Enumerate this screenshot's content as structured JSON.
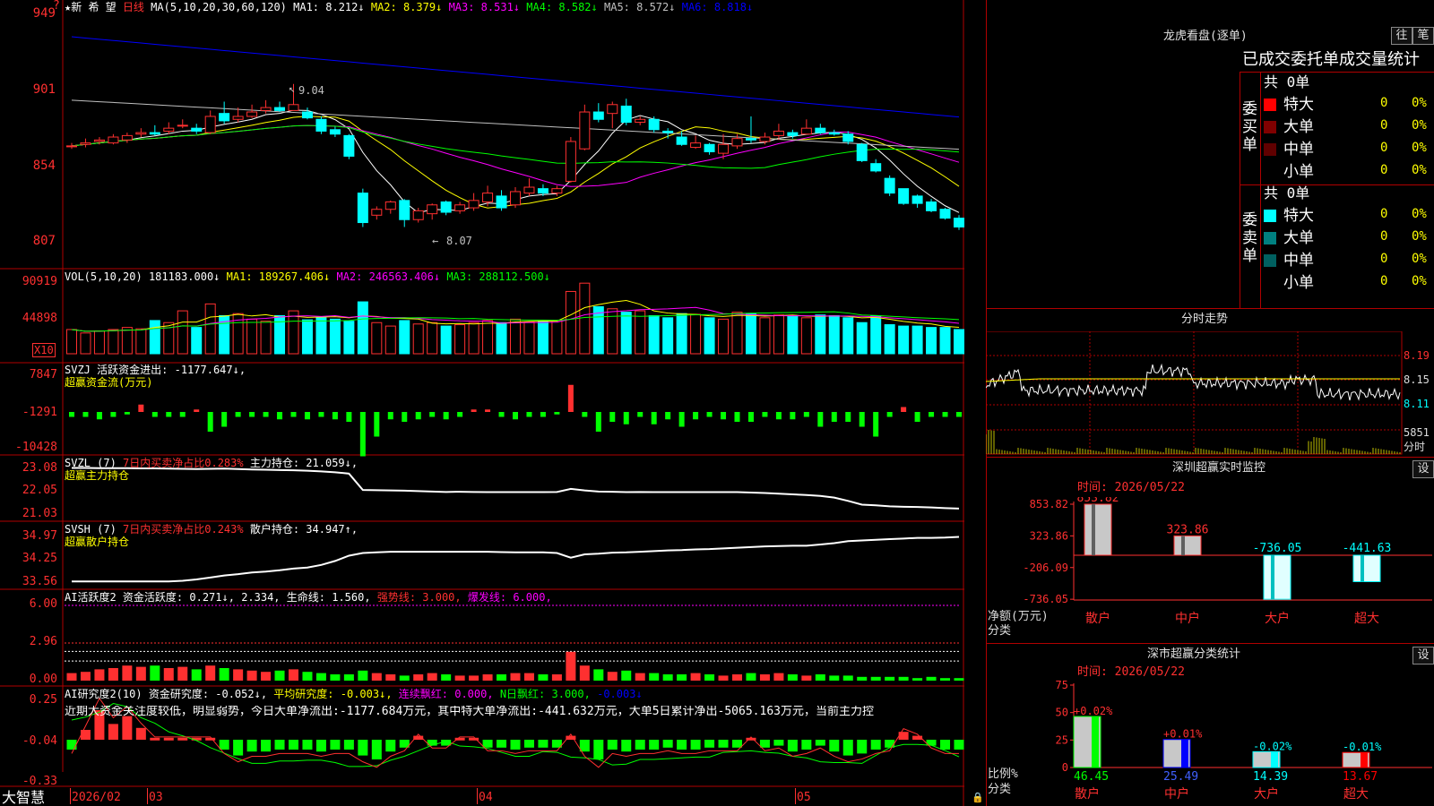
{
  "colors": {
    "up": "#ff3030",
    "down": "#00ffff",
    "grid": "#b00000",
    "ma1": "#ffffff",
    "ma2": "#ffff00",
    "ma3": "#ff00ff",
    "ma4": "#00ff00",
    "ma5": "#c0c0c0",
    "ma6": "#0000ff",
    "green": "#00ff00",
    "yellow": "#ffff00"
  },
  "header": {
    "stock": "★新 希 望",
    "period": "日线",
    "ma_def": "MA(5,10,20,30,60,120)",
    "ma": [
      {
        "label": "MA1: 8.212↓",
        "color": "#ffffff"
      },
      {
        "label": "MA2: 8.379↓",
        "color": "#ffff00"
      },
      {
        "label": "MA3: 8.531↓",
        "color": "#ff00ff"
      },
      {
        "label": "MA4: 8.582↓",
        "color": "#00ff00"
      },
      {
        "label": "MA5: 8.572↓",
        "color": "#c0c0c0"
      },
      {
        "label": "MA6: 8.818↓",
        "color": "#0000ff"
      }
    ]
  },
  "price_panel": {
    "y_labels": [
      "949",
      "901",
      "854",
      "807"
    ],
    "high_mark": "9.04",
    "low_mark": "8.07",
    "corner": "?"
  },
  "vol_panel": {
    "title": "VOL(5,10,20)",
    "value": "181183.000↓",
    "ma1": "MA1: 189267.406↓",
    "ma2": "MA2: 246563.406↓",
    "ma3": "MA3: 288112.500↓",
    "y_labels": [
      "90919",
      "44898"
    ],
    "unit": "X10"
  },
  "svzj_panel": {
    "title": "SVZJ",
    "metric": "活跃资金进出: -1177.647↓,",
    "sub": "超赢资金流(万元)",
    "y_labels": [
      "7847",
      "-1291",
      "-10428"
    ]
  },
  "svzl_panel": {
    "title": "SVZL (7)",
    "ratio": "7日内买卖净占比0.283%",
    "hold": "主力持仓: 21.059↓,",
    "sub": "超赢主力持仓",
    "y_labels": [
      "23.08",
      "22.05",
      "21.03"
    ]
  },
  "svsh_panel": {
    "title": "SVSH (7)",
    "ratio": "7日内买卖净占比0.243%",
    "hold": "散户持仓: 34.947↑,",
    "sub": "超赢散户持仓",
    "y_labels": [
      "34.97",
      "34.25",
      "33.56"
    ]
  },
  "ai_active": {
    "title": "AI活跃度2",
    "a": "资金活跃度: 0.271↓,",
    "b": "2.334,",
    "c": "生命线: 1.560,",
    "d": "强势线: 3.000,",
    "e": "爆发线: 6.000,",
    "y_labels": [
      "6.00",
      "2.96",
      "0.00"
    ]
  },
  "ai_research": {
    "title": "AI研究度2(10)",
    "a": "资金研究度: -0.052↓,",
    "b": "平均研究度: -0.003↓,",
    "c": "连续飘红: 0.000,",
    "d": "N日飘红: 3.000,",
    "e": "-0.003↓",
    "comment": "近期大资金关注度较低，明显弱势，今日大单净流出:-1177.684万元，其中特大单净流出:-441.632万元，大单5日累计净出-5065.163万元，当前主力控",
    "y_labels": [
      "0.25",
      "-0.04",
      "-0.33"
    ]
  },
  "bottom_bar": {
    "brand": "大智慧",
    "dates": [
      "2026/02",
      "03",
      "04",
      "05"
    ]
  },
  "right": {
    "top_title": "龙虎看盘(逐单)",
    "tabs": [
      "往",
      "笔"
    ],
    "table_title": "已成交委托单成交量统计",
    "buy": {
      "side": "委买单",
      "total": "共 0单",
      "rows": [
        {
          "label": "特大",
          "v": "0",
          "p": "0%",
          "c": "#ff0000"
        },
        {
          "label": "大单",
          "v": "0",
          "p": "0%",
          "c": "#800000"
        },
        {
          "label": "中单",
          "v": "0",
          "p": "0%",
          "c": "#600000"
        },
        {
          "label": "小单",
          "v": "0",
          "p": "0%",
          "c": "#000000"
        }
      ]
    },
    "sell": {
      "side": "委卖单",
      "total": "共 0单",
      "rows": [
        {
          "label": "特大",
          "v": "0",
          "p": "0%",
          "c": "#00ffff"
        },
        {
          "label": "大单",
          "v": "0",
          "p": "0%",
          "c": "#008080"
        },
        {
          "label": "中单",
          "v": "0",
          "p": "0%",
          "c": "#006060"
        },
        {
          "label": "小单",
          "v": "0",
          "p": "0%",
          "c": "#000000"
        }
      ]
    },
    "intraday": {
      "title": "分时走势",
      "y_labels": [
        "8.19",
        "8.15",
        "8.11"
      ],
      "vol_label": "5851",
      "vol_unit": "分时"
    },
    "monitor": {
      "title": "深圳超赢实时监控",
      "set": "设",
      "time": "时间: 2026/05/22",
      "y_labels": [
        "853.82",
        "323.86",
        "-206.09",
        "-736.05"
      ],
      "ylabel": "净额(万元)",
      "xlabel": "分类",
      "bars": [
        {
          "cat": "散户",
          "value": 853.82,
          "label": "853.82"
        },
        {
          "cat": "中户",
          "value": 323.86,
          "label": "323.86"
        },
        {
          "cat": "大户",
          "value": -736.05,
          "label": "-736.05"
        },
        {
          "cat": "超大",
          "value": -441.63,
          "label": "-441.63"
        }
      ]
    },
    "classify": {
      "title": "深市超赢分类统计",
      "set": "设",
      "time": "时间: 2026/05/22",
      "y_labels": [
        "75",
        "50",
        "25",
        "0"
      ],
      "ylabel": "比例%",
      "xlabel": "分类",
      "bars": [
        {
          "cat": "散户",
          "value": 46.45,
          "top": "+0.02%",
          "bottom": "46.45",
          "color": "#00ff00"
        },
        {
          "cat": "中户",
          "value": 25.49,
          "top": "+0.01%",
          "bottom": "25.49",
          "color": "#0000ff"
        },
        {
          "cat": "大户",
          "value": 14.39,
          "top": "-0.02%",
          "bottom": "14.39",
          "color": "#00ffff"
        },
        {
          "cat": "超大",
          "value": 13.67,
          "top": "-0.01%",
          "bottom": "13.67",
          "color": "#ff0000"
        }
      ]
    }
  },
  "chart_data": {
    "type": "candlestick",
    "ylim": [
      8.0,
      9.5
    ],
    "candles": [
      [
        8.62,
        8.62,
        8.64,
        8.6
      ],
      [
        8.63,
        8.64,
        8.67,
        8.61
      ],
      [
        8.65,
        8.66,
        8.68,
        8.63
      ],
      [
        8.64,
        8.68,
        8.7,
        8.63
      ],
      [
        8.66,
        8.69,
        8.71,
        8.64
      ],
      [
        8.7,
        8.71,
        8.74,
        8.68
      ],
      [
        8.71,
        8.7,
        8.76,
        8.69
      ],
      [
        8.72,
        8.74,
        8.78,
        8.7
      ],
      [
        8.76,
        8.76,
        8.8,
        8.74
      ],
      [
        8.74,
        8.72,
        8.77,
        8.7
      ],
      [
        8.71,
        8.82,
        8.86,
        8.7
      ],
      [
        8.84,
        8.79,
        8.92,
        8.77
      ],
      [
        8.8,
        8.82,
        8.88,
        8.78
      ],
      [
        8.82,
        8.85,
        8.9,
        8.81
      ],
      [
        8.86,
        8.88,
        8.93,
        8.84
      ],
      [
        8.88,
        8.86,
        8.92,
        8.85
      ],
      [
        8.86,
        8.9,
        9.04,
        8.86
      ],
      [
        8.85,
        8.81,
        8.88,
        8.8
      ],
      [
        8.8,
        8.72,
        8.82,
        8.7
      ],
      [
        8.73,
        8.7,
        8.75,
        8.68
      ],
      [
        8.69,
        8.55,
        8.7,
        8.53
      ],
      [
        8.3,
        8.1,
        8.33,
        8.07
      ],
      [
        8.15,
        8.19,
        8.21,
        8.12
      ],
      [
        8.19,
        8.24,
        8.25,
        8.16
      ],
      [
        8.25,
        8.12,
        8.26,
        8.07
      ],
      [
        8.12,
        8.18,
        8.2,
        8.1
      ],
      [
        8.16,
        8.22,
        8.23,
        8.12
      ],
      [
        8.24,
        8.17,
        8.25,
        8.15
      ],
      [
        8.18,
        8.22,
        8.24,
        8.16
      ],
      [
        8.2,
        8.25,
        8.3,
        8.18
      ],
      [
        8.24,
        8.3,
        8.35,
        8.21
      ],
      [
        8.28,
        8.2,
        8.32,
        8.18
      ],
      [
        8.22,
        8.31,
        8.34,
        8.2
      ],
      [
        8.3,
        8.34,
        8.4,
        8.28
      ],
      [
        8.33,
        8.3,
        8.36,
        8.28
      ],
      [
        8.3,
        8.33,
        8.35,
        8.28
      ],
      [
        8.38,
        8.65,
        8.68,
        8.37
      ],
      [
        8.6,
        8.85,
        8.9,
        8.59
      ],
      [
        8.85,
        8.8,
        8.91,
        8.78
      ],
      [
        8.84,
        8.9,
        8.92,
        8.74
      ],
      [
        8.89,
        8.78,
        8.94,
        8.76
      ],
      [
        8.78,
        8.8,
        8.82,
        8.76
      ],
      [
        8.8,
        8.73,
        8.82,
        8.71
      ],
      [
        8.72,
        8.71,
        8.74,
        8.67
      ],
      [
        8.68,
        8.63,
        8.72,
        8.62
      ],
      [
        8.61,
        8.64,
        8.69,
        8.6
      ],
      [
        8.63,
        8.58,
        8.64,
        8.56
      ],
      [
        8.57,
        8.63,
        8.7,
        8.53
      ],
      [
        8.62,
        8.67,
        8.7,
        8.6
      ],
      [
        8.67,
        8.66,
        8.82,
        8.64
      ],
      [
        8.65,
        8.68,
        8.71,
        8.63
      ],
      [
        8.69,
        8.72,
        8.77,
        8.66
      ],
      [
        8.71,
        8.69,
        8.73,
        8.67
      ],
      [
        8.7,
        8.74,
        8.8,
        8.7
      ],
      [
        8.74,
        8.71,
        8.77,
        8.7
      ],
      [
        8.71,
        8.7,
        8.73,
        8.69
      ],
      [
        8.7,
        8.65,
        8.72,
        8.63
      ],
      [
        8.63,
        8.52,
        8.64,
        8.51
      ],
      [
        8.5,
        8.45,
        8.53,
        8.44
      ],
      [
        8.4,
        8.3,
        8.42,
        8.28
      ],
      [
        8.33,
        8.23,
        8.33,
        8.22
      ],
      [
        8.28,
        8.23,
        8.29,
        8.2
      ],
      [
        8.24,
        8.18,
        8.26,
        8.17
      ],
      [
        8.19,
        8.13,
        8.2,
        8.12
      ],
      [
        8.13,
        8.07,
        8.15,
        8.05
      ]
    ],
    "volume": [
      35,
      30,
      33,
      35,
      38,
      36,
      48,
      45,
      62,
      38,
      72,
      55,
      58,
      50,
      47,
      55,
      62,
      49,
      52,
      50,
      47,
      75,
      45,
      40,
      48,
      43,
      45,
      40,
      42,
      45,
      48,
      45,
      50,
      46,
      47,
      48,
      90,
      102,
      68,
      65,
      60,
      62,
      55,
      52,
      58,
      57,
      52,
      50,
      60,
      58,
      52,
      56,
      54,
      52,
      56,
      55,
      52,
      45,
      55,
      42,
      40,
      40,
      38,
      38,
      35
    ],
    "fund_flow": [
      -1,
      -1,
      -1.5,
      -1,
      -0.5,
      1.5,
      -1,
      -1,
      -1,
      0.5,
      -4,
      -3,
      -1,
      -1,
      -1,
      -1.5,
      -1,
      -1.5,
      -1,
      -1.5,
      -2,
      -9,
      -5,
      -1.5,
      -2,
      -1.5,
      -1,
      -1.5,
      -1,
      0.5,
      0.5,
      -1,
      -1.5,
      -1,
      -1,
      -0.5,
      5.5,
      -1,
      -4,
      -2,
      -2.5,
      -1,
      -2.5,
      -1.5,
      -3,
      -1.5,
      -1,
      -1.5,
      -2,
      -2,
      -1,
      -1.5,
      -1.5,
      -1,
      -3,
      -2,
      -2,
      -3,
      -5,
      -1,
      1,
      -2,
      -1,
      -1,
      -1
    ],
    "main_hold": [
      23.06,
      23.06,
      23.05,
      23.05,
      23.05,
      23.04,
      23.04,
      23.03,
      23.02,
      23.01,
      23.02,
      23.03,
      23.01,
      22.99,
      22.98,
      22.96,
      22.95,
      22.93,
      22.9,
      22.86,
      22.8,
      22.05,
      22.04,
      22.03,
      22.02,
      22.0,
      21.98,
      21.96,
      21.97,
      21.96,
      21.95,
      21.95,
      21.95,
      21.95,
      21.95,
      21.96,
      22.1,
      22.03,
      21.98,
      21.97,
      21.95,
      21.96,
      21.95,
      21.95,
      21.95,
      21.95,
      21.95,
      21.95,
      21.95,
      21.93,
      21.91,
      21.88,
      21.85,
      21.82,
      21.78,
      21.7,
      21.55,
      21.38,
      21.35,
      21.3,
      21.28,
      21.27,
      21.25,
      21.22,
      21.2
    ],
    "retail_hold": [
      33.58,
      33.58,
      33.58,
      33.58,
      33.58,
      33.58,
      33.58,
      33.58,
      33.6,
      33.64,
      33.7,
      33.76,
      33.8,
      33.85,
      33.88,
      33.92,
      33.97,
      34.0,
      34.08,
      34.2,
      34.36,
      34.44,
      34.46,
      34.48,
      34.48,
      34.48,
      34.48,
      34.48,
      34.48,
      34.48,
      34.48,
      34.47,
      34.46,
      34.46,
      34.46,
      34.44,
      34.3,
      34.4,
      34.42,
      34.45,
      34.46,
      34.48,
      34.5,
      34.52,
      34.53,
      34.55,
      34.56,
      34.58,
      34.6,
      34.62,
      34.64,
      34.65,
      34.66,
      34.66,
      34.7,
      34.74,
      34.8,
      34.82,
      34.84,
      34.86,
      34.88,
      34.9,
      34.9,
      34.91,
      34.93
    ],
    "ai_active": [
      0.6,
      0.7,
      0.9,
      1.0,
      1.2,
      1.1,
      1.2,
      1.0,
      1.1,
      0.9,
      1.2,
      1.0,
      0.9,
      0.8,
      0.7,
      0.8,
      0.9,
      0.7,
      0.6,
      0.5,
      0.5,
      0.8,
      0.6,
      0.5,
      0.4,
      0.5,
      0.6,
      0.5,
      0.4,
      0.4,
      0.5,
      0.5,
      0.6,
      0.6,
      0.5,
      0.5,
      2.3,
      1.2,
      0.9,
      0.7,
      0.8,
      0.6,
      0.6,
      0.5,
      0.5,
      0.6,
      0.5,
      0.4,
      0.5,
      0.6,
      0.5,
      0.6,
      0.5,
      0.4,
      0.5,
      0.4,
      0.4,
      0.3,
      0.3,
      0.3,
      0.3,
      0.2,
      0.3,
      0.2,
      0.2
    ],
    "ai_research": [
      -0.05,
      0.05,
      0.15,
      0.08,
      0.12,
      0.06,
      0.01,
      0.01,
      0.01,
      0.01,
      0.01,
      -0.05,
      -0.08,
      -0.06,
      -0.06,
      -0.05,
      -0.05,
      -0.05,
      -0.06,
      -0.05,
      -0.05,
      -0.08,
      -0.1,
      -0.06,
      -0.04,
      0.02,
      -0.03,
      -0.03,
      0.01,
      0.01,
      -0.04,
      -0.04,
      -0.05,
      -0.04,
      -0.04,
      -0.04,
      0.02,
      -0.06,
      -0.1,
      -0.05,
      -0.06,
      -0.05,
      -0.05,
      -0.04,
      -0.05,
      -0.05,
      -0.04,
      -0.04,
      -0.04,
      0.01,
      -0.04,
      -0.03,
      -0.06,
      -0.05,
      -0.03,
      -0.06,
      -0.08,
      -0.07,
      -0.05,
      -0.04,
      0.04,
      0.02,
      -0.03,
      -0.05,
      -0.05
    ]
  }
}
